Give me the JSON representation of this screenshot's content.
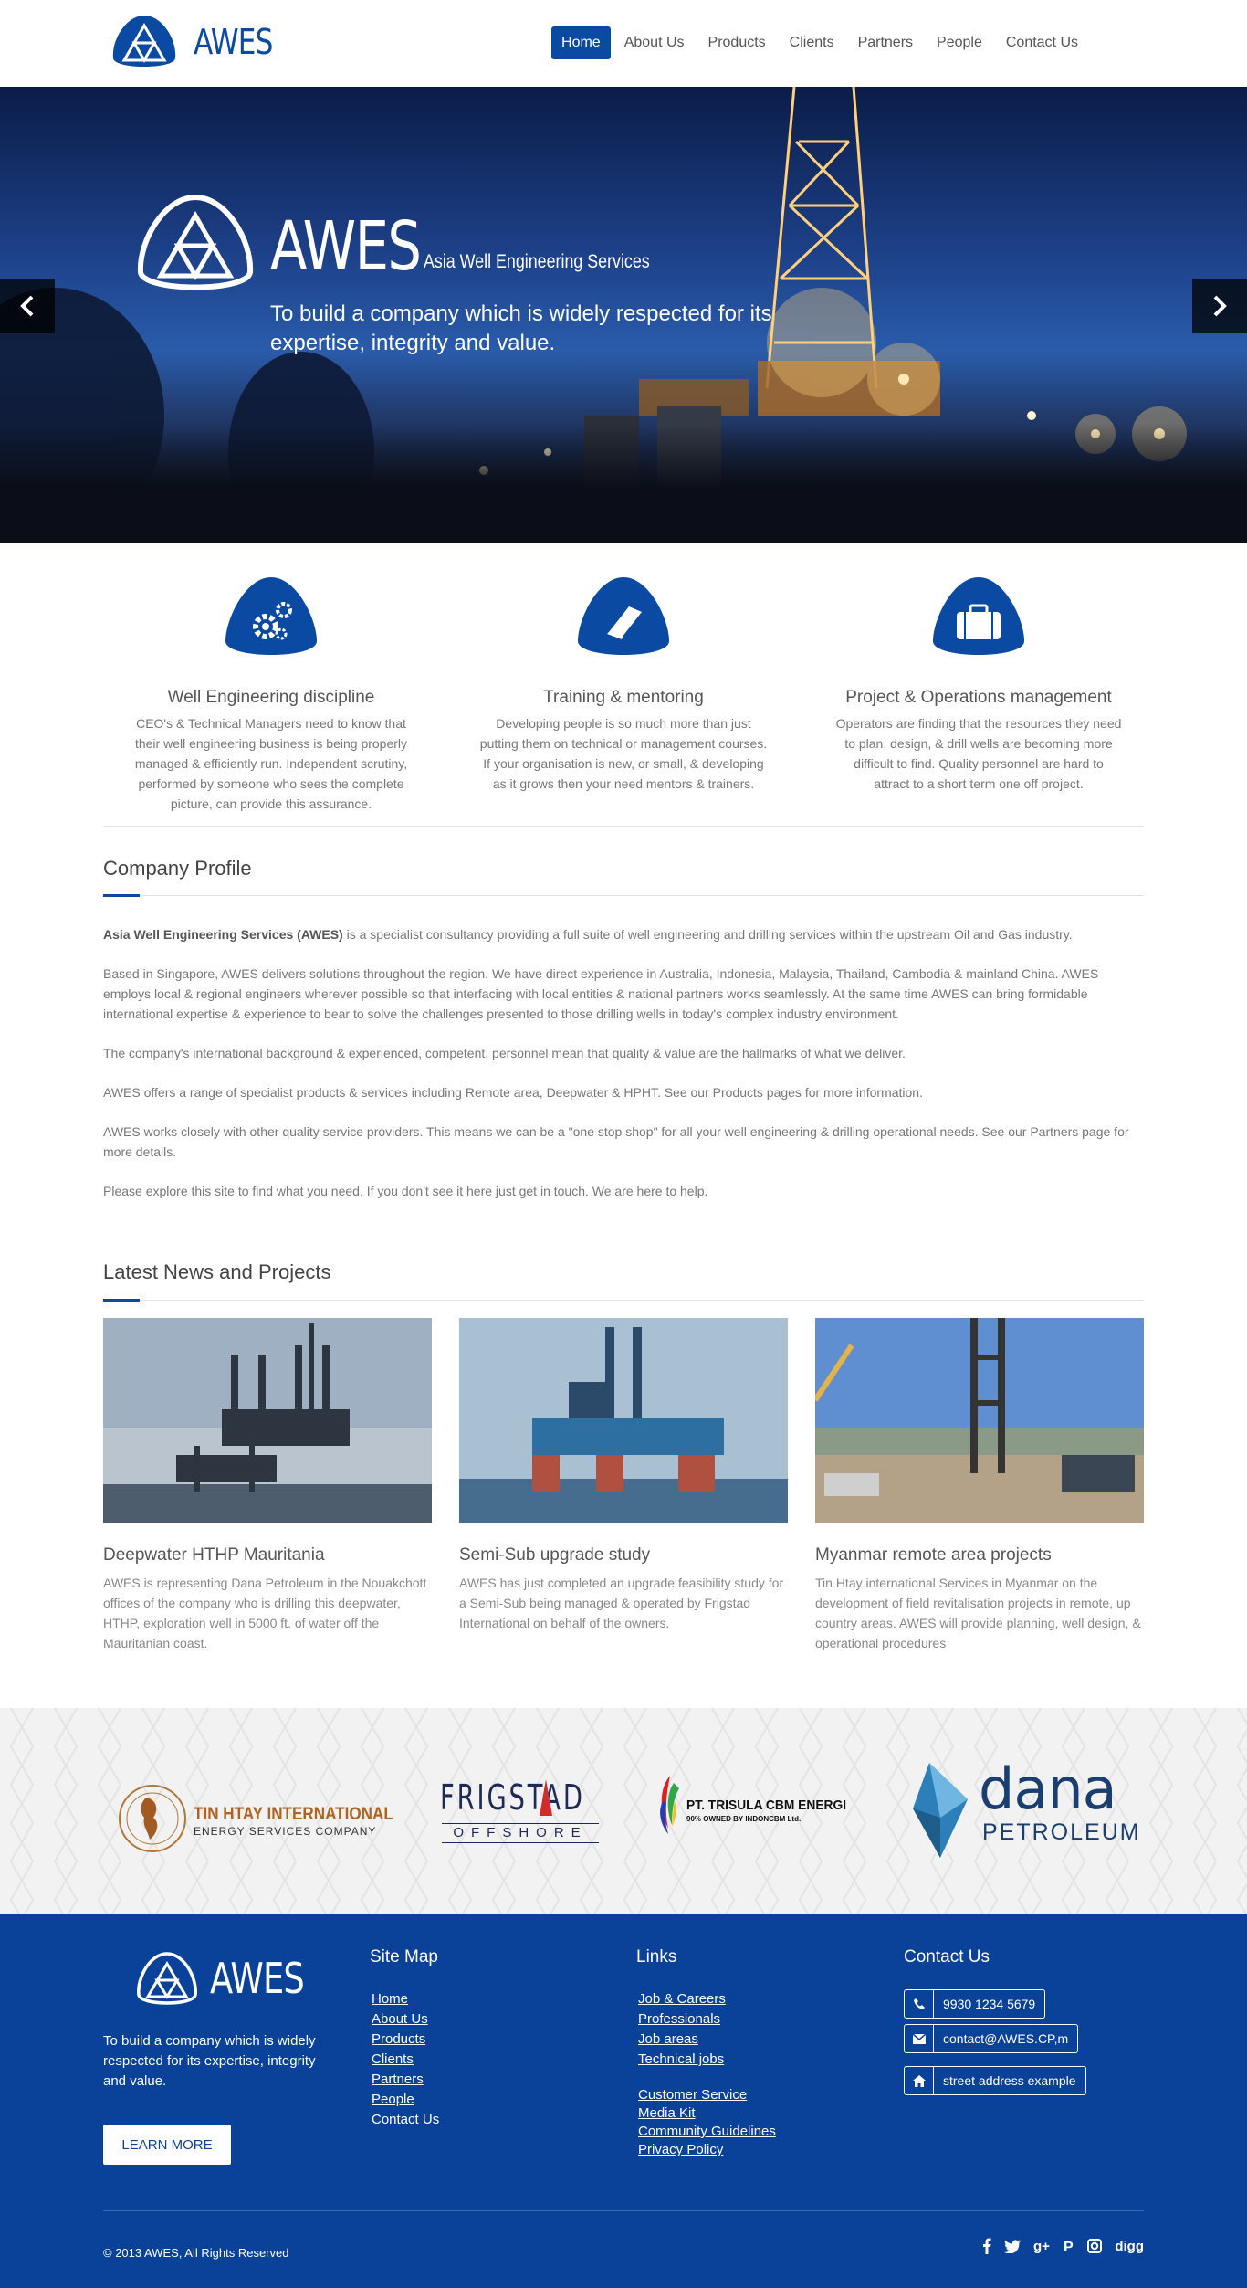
{
  "brand": {
    "name": "AWES",
    "color": "#0b4aa2",
    "footer_bg": "#0a4299"
  },
  "nav": {
    "items": [
      "Home",
      "About Us",
      "Products",
      "Clients",
      "Partners",
      "People",
      "Contact Us"
    ],
    "active": "Home"
  },
  "hero": {
    "title": "AWES",
    "subtitle": "Asia Well Engineering Services",
    "tagline": "To build a company which is widely respected for its expertise, integrity and value."
  },
  "features": [
    {
      "icon": "gears-icon",
      "title": "Well Engineering discipline",
      "text": "CEO's & Technical Managers need to know that their well engineering business is being properly managed & efficiently run. Independent scrutiny, performed by someone who sees the complete picture, can provide this assurance."
    },
    {
      "icon": "book-icon",
      "title": "Training & mentoring",
      "text": "Developing people is so much more than just putting them on technical or management courses. If your organisation is new, or small, & developing as it grows then your need mentors & trainers."
    },
    {
      "icon": "briefcase-icon",
      "title": "Project & Operations management",
      "text": "Operators are finding that the resources they need to plan, design, & drill wells are becoming more difficult to find. Quality personnel are hard to attract to a short term one off project."
    }
  ],
  "profile": {
    "title": "Company Profile",
    "lead_bold": "Asia Well Engineering Services (AWES)",
    "lead_rest": " is a specialist consultancy providing a full suite of well engineering and drilling services within the upstream Oil and Gas industry.",
    "paragraphs": [
      "Based in Singapore, AWES delivers solutions throughout the region. We have direct experience in Australia, Indonesia, Malaysia, Thailand, Cambodia & mainland China. AWES employs local & regional engineers wherever possible so that interfacing with local entities & national partners works seamlessly. At the same time AWES can bring formidable international expertise & experience to bear to solve the challenges presented to those drilling wells in today's complex industry environment.",
      "The company's international background & experienced, competent, personnel mean that quality & value are the hallmarks of what we deliver.",
      "AWES offers a range of specialist products & services including Remote area, Deepwater & HPHT. See our Products pages for more information.",
      "AWES works closely with other quality service providers. This means we can be a \"one stop shop\" for all your well engineering & drilling operational  needs. See our Partners page for more details.",
      "Please explore this site to find what you need. If you don't see it here just get in touch. We are here to help."
    ]
  },
  "news": {
    "title": "Latest News and Projects",
    "items": [
      {
        "title": "Deepwater HTHP Mauritania",
        "text": "AWES is representing Dana Petroleum in the Nouakchott offices of the company who is drilling this deepwater, HTHP, exploration well in 5000 ft. of water off the Mauritanian coast."
      },
      {
        "title": "Semi-Sub upgrade study",
        "text": "AWES has just completed an upgrade feasibility study for a Semi-Sub being managed & operated by Frigstad International on behalf of the owners."
      },
      {
        "title": "Myanmar remote area projects",
        "text": "Tin Htay international Services in Myanmar on the development of field revitalisation projects in remote, up country areas. AWES will provide planning, well design, & operational procedures"
      }
    ]
  },
  "partners": {
    "tin_htay": {
      "name": "TIN HTAY INTERNATIONAL",
      "sub": "ENERGY SERVICES COMPANY"
    },
    "frigstad": {
      "name": "FRIGSTAD",
      "sub": "OFFSHORE"
    },
    "trisula": {
      "name": "PT. TRISULA CBM ENERGI",
      "sub": "90% OWNED BY INDONCBM Ltd."
    },
    "dana": {
      "name": "dana",
      "sub": "PETROLEUM"
    }
  },
  "footer": {
    "brand": "AWES",
    "tagline": "To build a company which is widely respected for its expertise, integrity and value.",
    "learn_more": "LEARN MORE",
    "sitemap_title": "Site Map",
    "sitemap": [
      "Home",
      "About Us",
      "Products",
      "Clients",
      "Partners",
      "People",
      "Contact Us"
    ],
    "links_title": "Links",
    "links_a": [
      "Job & Careers",
      "Professionals",
      "Job areas",
      "Technical jobs"
    ],
    "links_b": [
      "Customer Service",
      "Media Kit",
      "Community Guidelines",
      "Privacy Policy"
    ],
    "contact_title": "Contact Us",
    "phone": "9930 1234 5679",
    "email": "contact@AWES.CP,m",
    "address": "street address example",
    "copyright": "© 2013 AWES, All Rights Reserved",
    "social": [
      "facebook-icon",
      "twitter-icon",
      "google-plus-icon",
      "pinterest-icon",
      "instagram-icon",
      "digg-icon"
    ],
    "digg_label": "digg"
  }
}
